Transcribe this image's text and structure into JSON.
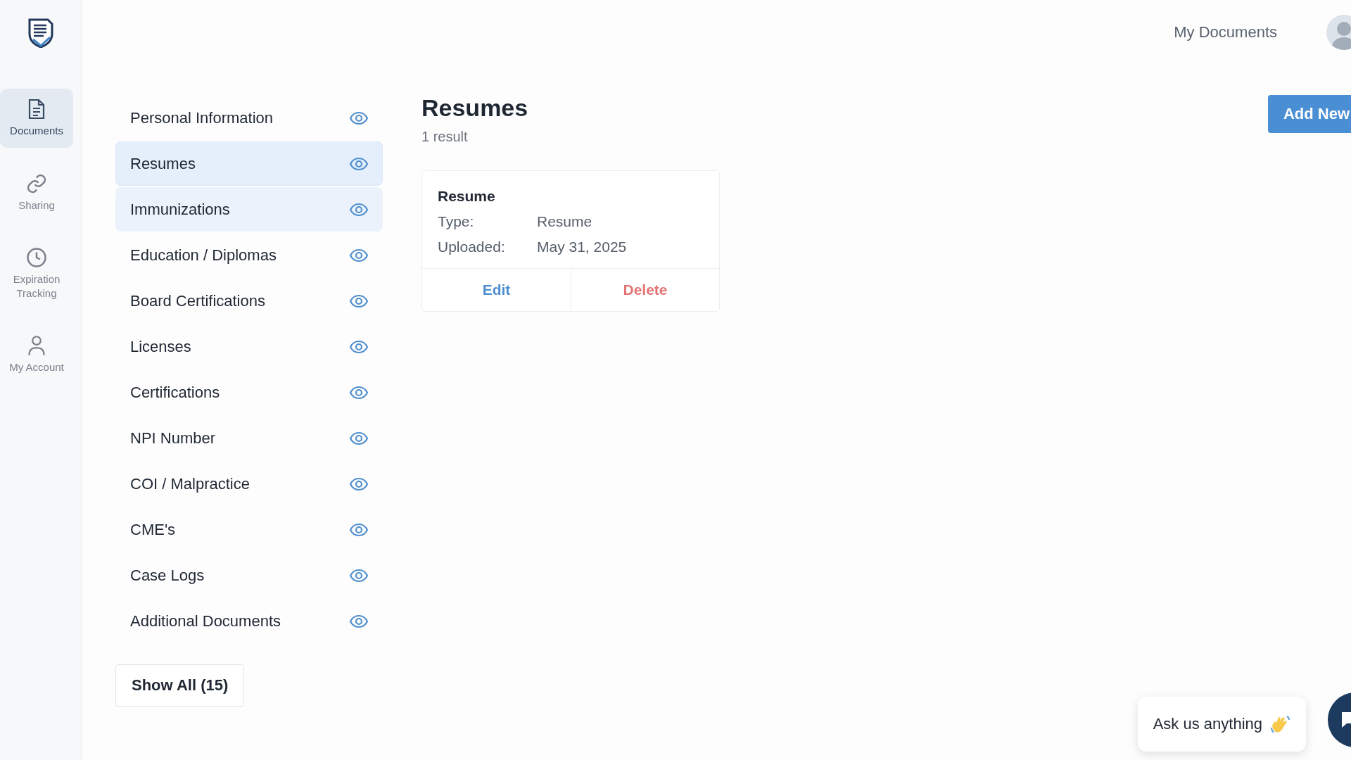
{
  "nav": [
    {
      "label": "Documents",
      "selected": true
    },
    {
      "label": "Sharing",
      "selected": false
    },
    {
      "label": "Expiration Tracking",
      "selected": false
    },
    {
      "label": "My Account",
      "selected": false
    }
  ],
  "header": {
    "title": "My Documents"
  },
  "categories": [
    {
      "label": "Personal Information",
      "selected": false,
      "hovered": false
    },
    {
      "label": "Resumes",
      "selected": true,
      "hovered": false
    },
    {
      "label": "Immunizations",
      "selected": false,
      "hovered": true
    },
    {
      "label": "Education / Diplomas",
      "selected": false,
      "hovered": false
    },
    {
      "label": "Board Certifications",
      "selected": false,
      "hovered": false
    },
    {
      "label": "Licenses",
      "selected": false,
      "hovered": false
    },
    {
      "label": "Certifications",
      "selected": false,
      "hovered": false
    },
    {
      "label": "NPI Number",
      "selected": false,
      "hovered": false
    },
    {
      "label": "COI / Malpractice",
      "selected": false,
      "hovered": false
    },
    {
      "label": "CME's",
      "selected": false,
      "hovered": false
    },
    {
      "label": "Case Logs",
      "selected": false,
      "hovered": false
    },
    {
      "label": "Additional Documents",
      "selected": false,
      "hovered": false
    }
  ],
  "show_all": "Show All (15)",
  "section": {
    "title": "Resumes",
    "count": "1 result",
    "add_button": "Add New"
  },
  "documents": [
    {
      "title": "Resume",
      "fields": [
        {
          "label": "Type:",
          "value": "Resume"
        },
        {
          "label": "Uploaded:",
          "value": "May 31, 2025"
        }
      ],
      "actions": [
        {
          "label": "Edit",
          "kind": "edit"
        },
        {
          "label": "Delete",
          "kind": "delete"
        }
      ]
    }
  ],
  "chat": {
    "prompt": "Ask us anything"
  }
}
